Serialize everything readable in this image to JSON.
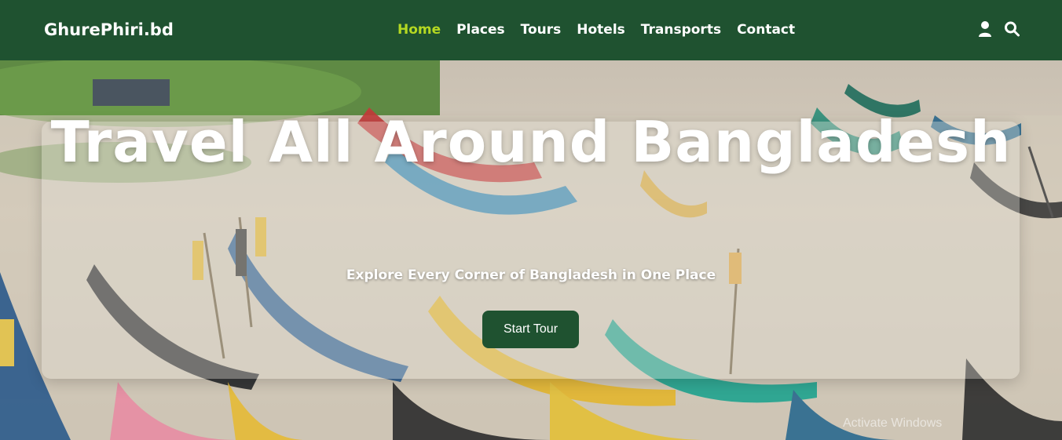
{
  "brand": {
    "name": "GhurePhiri.bd"
  },
  "nav": {
    "items": [
      {
        "label": "Home",
        "active": true
      },
      {
        "label": "Places",
        "active": false
      },
      {
        "label": "Tours",
        "active": false
      },
      {
        "label": "Hotels",
        "active": false
      },
      {
        "label": "Transports",
        "active": false
      },
      {
        "label": "Contact",
        "active": false
      }
    ],
    "icons": [
      "user-icon",
      "search-icon"
    ]
  },
  "hero": {
    "title": "Travel All Around Bangladesh",
    "subtitle": "Explore Every Corner of Bangladesh in One Place",
    "cta_label": "Start Tour",
    "background": "fishing-boats-on-beach-photo"
  },
  "watermark": "Activate Windows",
  "colors": {
    "navbar": "#1f5230",
    "active_link": "#b5d822",
    "button": "#1f5230",
    "text": "#ffffff"
  }
}
